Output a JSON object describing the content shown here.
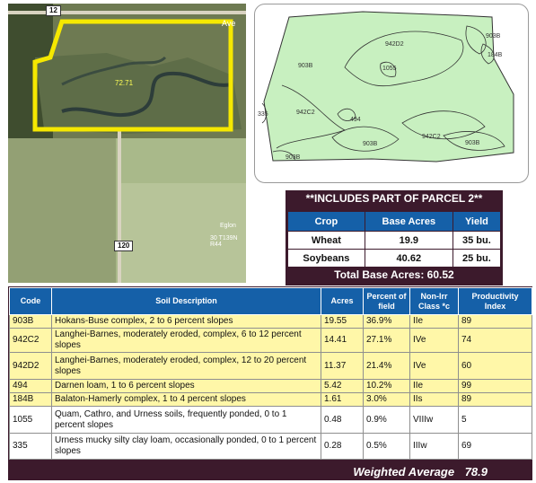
{
  "aerial": {
    "road_north": "12",
    "road_south": "120",
    "acres_label": "72.71",
    "street_label": "Ave",
    "place_label": "Eglon",
    "place_sublabel": "30 T139N R44"
  },
  "soil_map": {
    "labels": [
      "942D2",
      "903B",
      "184B",
      "1055",
      "903B",
      "335",
      "942C2",
      "494",
      "903B",
      "942C2",
      "903B",
      "903B"
    ],
    "fill_color": "#c8f0c0"
  },
  "parcel_note": "**INCLUDES PART OF PARCEL 2**",
  "crop_table": {
    "headers": [
      "Crop",
      "Base Acres",
      "Yield"
    ],
    "rows": [
      {
        "crop": "Wheat",
        "base_acres": "19.9",
        "yield": "35 bu."
      },
      {
        "crop": "Soybeans",
        "base_acres": "40.62",
        "yield": "25 bu."
      }
    ],
    "total_label": "Total Base Acres:",
    "total_value": "60.52"
  },
  "soil_table": {
    "headers": {
      "code": "Code",
      "description": "Soil Description",
      "acres": "Acres",
      "percent": "Percent of field",
      "class": "Non-Irr Class *c",
      "productivity": "Productivity Index"
    },
    "rows": [
      {
        "code": "903B",
        "description": "Hokans-Buse complex, 2 to 6 percent slopes",
        "acres": "19.55",
        "percent": "36.9%",
        "class": "IIe",
        "productivity": "89"
      },
      {
        "code": "942C2",
        "description": "Langhei-Barnes, moderately eroded, complex, 6 to 12 percent slopes",
        "acres": "14.41",
        "percent": "27.1%",
        "class": "IVe",
        "productivity": "74"
      },
      {
        "code": "942D2",
        "description": "Langhei-Barnes, moderately eroded, complex, 12 to 20 percent slopes",
        "acres": "11.37",
        "percent": "21.4%",
        "class": "IVe",
        "productivity": "60"
      },
      {
        "code": "494",
        "description": "Darnen loam, 1 to 6 percent slopes",
        "acres": "5.42",
        "percent": "10.2%",
        "class": "IIe",
        "productivity": "99"
      },
      {
        "code": "184B",
        "description": "Balaton-Hamerly complex, 1 to 4 percent slopes",
        "acres": "1.61",
        "percent": "3.0%",
        "class": "IIs",
        "productivity": "89"
      },
      {
        "code": "1055",
        "description": "Quam, Cathro, and Urness soils, frequently ponded, 0 to 1 percent slopes",
        "acres": "0.48",
        "percent": "0.9%",
        "class": "VIIIw",
        "productivity": "5"
      },
      {
        "code": "335",
        "description": "Urness mucky silty clay loam, occasionally ponded, 0 to 1 percent slopes",
        "acres": "0.28",
        "percent": "0.5%",
        "class": "IIIw",
        "productivity": "69"
      }
    ],
    "weighted_label": "Weighted Average",
    "weighted_value": "78.9"
  }
}
